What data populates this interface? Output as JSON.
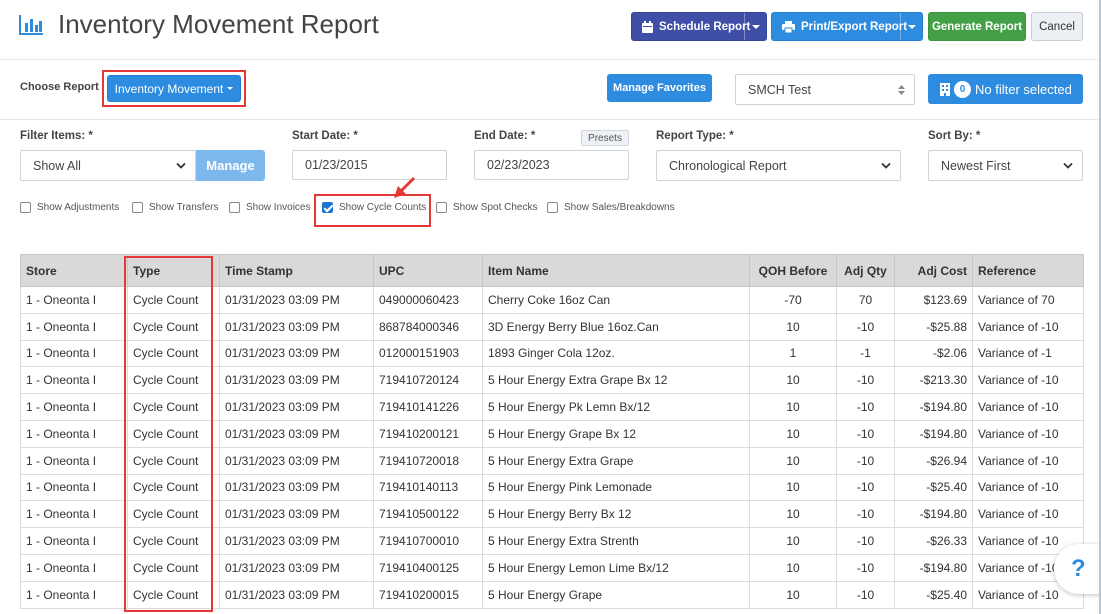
{
  "header": {
    "title": "Inventory Movement Report",
    "schedule_label": "Schedule Report",
    "print_label": "Print/Export Report",
    "generate_label": "Generate Report",
    "cancel_label": "Cancel"
  },
  "choose": {
    "label": "Choose Report",
    "report_button": "Inventory Movement",
    "favorites_label": "Manage Favorites",
    "store_value": "SMCH Test",
    "filter_count": "0",
    "filter_label": "No filter selected"
  },
  "filters": {
    "filter_items_label": "Filter Items: *",
    "filter_items_value": "Show All",
    "manage_label": "Manage",
    "start_label": "Start Date: *",
    "start_value": "01/23/2015",
    "end_label": "End Date: *",
    "presets_label": "Presets",
    "end_value": "02/23/2023",
    "report_type_label": "Report Type: *",
    "report_type_value": "Chronological Report",
    "sort_label": "Sort By: *",
    "sort_value": "Newest First"
  },
  "checkboxes": [
    {
      "label": "Show Adjustments",
      "checked": false
    },
    {
      "label": "Show Transfers",
      "checked": false
    },
    {
      "label": "Show Invoices",
      "checked": false
    },
    {
      "label": "Show Cycle Counts",
      "checked": true
    },
    {
      "label": "Show Spot Checks",
      "checked": false
    },
    {
      "label": "Show Sales/Breakdowns",
      "checked": false
    }
  ],
  "table": {
    "columns": [
      "Store",
      "Type",
      "Time Stamp",
      "UPC",
      "Item Name",
      "QOH Before",
      "Adj Qty",
      "Adj Cost",
      "Reference"
    ],
    "rows": [
      [
        "1 - Oneonta I",
        "Cycle Count",
        "01/31/2023 03:09 PM",
        "049000060423",
        "Cherry Coke 16oz Can",
        "-70",
        "70",
        "$123.69",
        "Variance of 70"
      ],
      [
        "1 - Oneonta I",
        "Cycle Count",
        "01/31/2023 03:09 PM",
        "868784000346",
        "3D Energy Berry Blue 16oz.Can",
        "10",
        "-10",
        "-$25.88",
        "Variance of -10"
      ],
      [
        "1 - Oneonta I",
        "Cycle Count",
        "01/31/2023 03:09 PM",
        "012000151903",
        "1893 Ginger Cola 12oz.",
        "1",
        "-1",
        "-$2.06",
        "Variance of -1"
      ],
      [
        "1 - Oneonta I",
        "Cycle Count",
        "01/31/2023 03:09 PM",
        "719410720124",
        "5 Hour Energy Extra Grape Bx 12",
        "10",
        "-10",
        "-$213.30",
        "Variance of -10"
      ],
      [
        "1 - Oneonta I",
        "Cycle Count",
        "01/31/2023 03:09 PM",
        "719410141226",
        "5 Hour Energy Pk Lemn Bx/12",
        "10",
        "-10",
        "-$194.80",
        "Variance of -10"
      ],
      [
        "1 - Oneonta I",
        "Cycle Count",
        "01/31/2023 03:09 PM",
        "719410200121",
        "5 Hour Energy Grape Bx 12",
        "10",
        "-10",
        "-$194.80",
        "Variance of -10"
      ],
      [
        "1 - Oneonta I",
        "Cycle Count",
        "01/31/2023 03:09 PM",
        "719410720018",
        "5 Hour Energy Extra Grape",
        "10",
        "-10",
        "-$26.94",
        "Variance of -10"
      ],
      [
        "1 - Oneonta I",
        "Cycle Count",
        "01/31/2023 03:09 PM",
        "719410140113",
        "5 Hour Energy Pink Lemonade",
        "10",
        "-10",
        "-$25.40",
        "Variance of -10"
      ],
      [
        "1 - Oneonta I",
        "Cycle Count",
        "01/31/2023 03:09 PM",
        "719410500122",
        "5 Hour Energy Berry Bx 12",
        "10",
        "-10",
        "-$194.80",
        "Variance of -10"
      ],
      [
        "1 - Oneonta I",
        "Cycle Count",
        "01/31/2023 03:09 PM",
        "719410700010",
        "5 Hour Energy Extra Strenth",
        "10",
        "-10",
        "-$26.33",
        "Variance of -10"
      ],
      [
        "1 - Oneonta I",
        "Cycle Count",
        "01/31/2023 03:09 PM",
        "719410400125",
        "5 Hour Energy Lemon Lime Bx/12",
        "10",
        "-10",
        "-$194.80",
        "Variance of -10"
      ],
      [
        "1 - Oneonta I",
        "Cycle Count",
        "01/31/2023 03:09 PM",
        "719410200015",
        "5 Hour Energy Grape",
        "10",
        "-10",
        "-$25.40",
        "Variance of -10"
      ]
    ]
  },
  "help_label": "?",
  "colors": {
    "primary": "#2d8be0",
    "schedule": "#3f4fa8",
    "generate": "#43a047",
    "highlight": "#e53935"
  }
}
